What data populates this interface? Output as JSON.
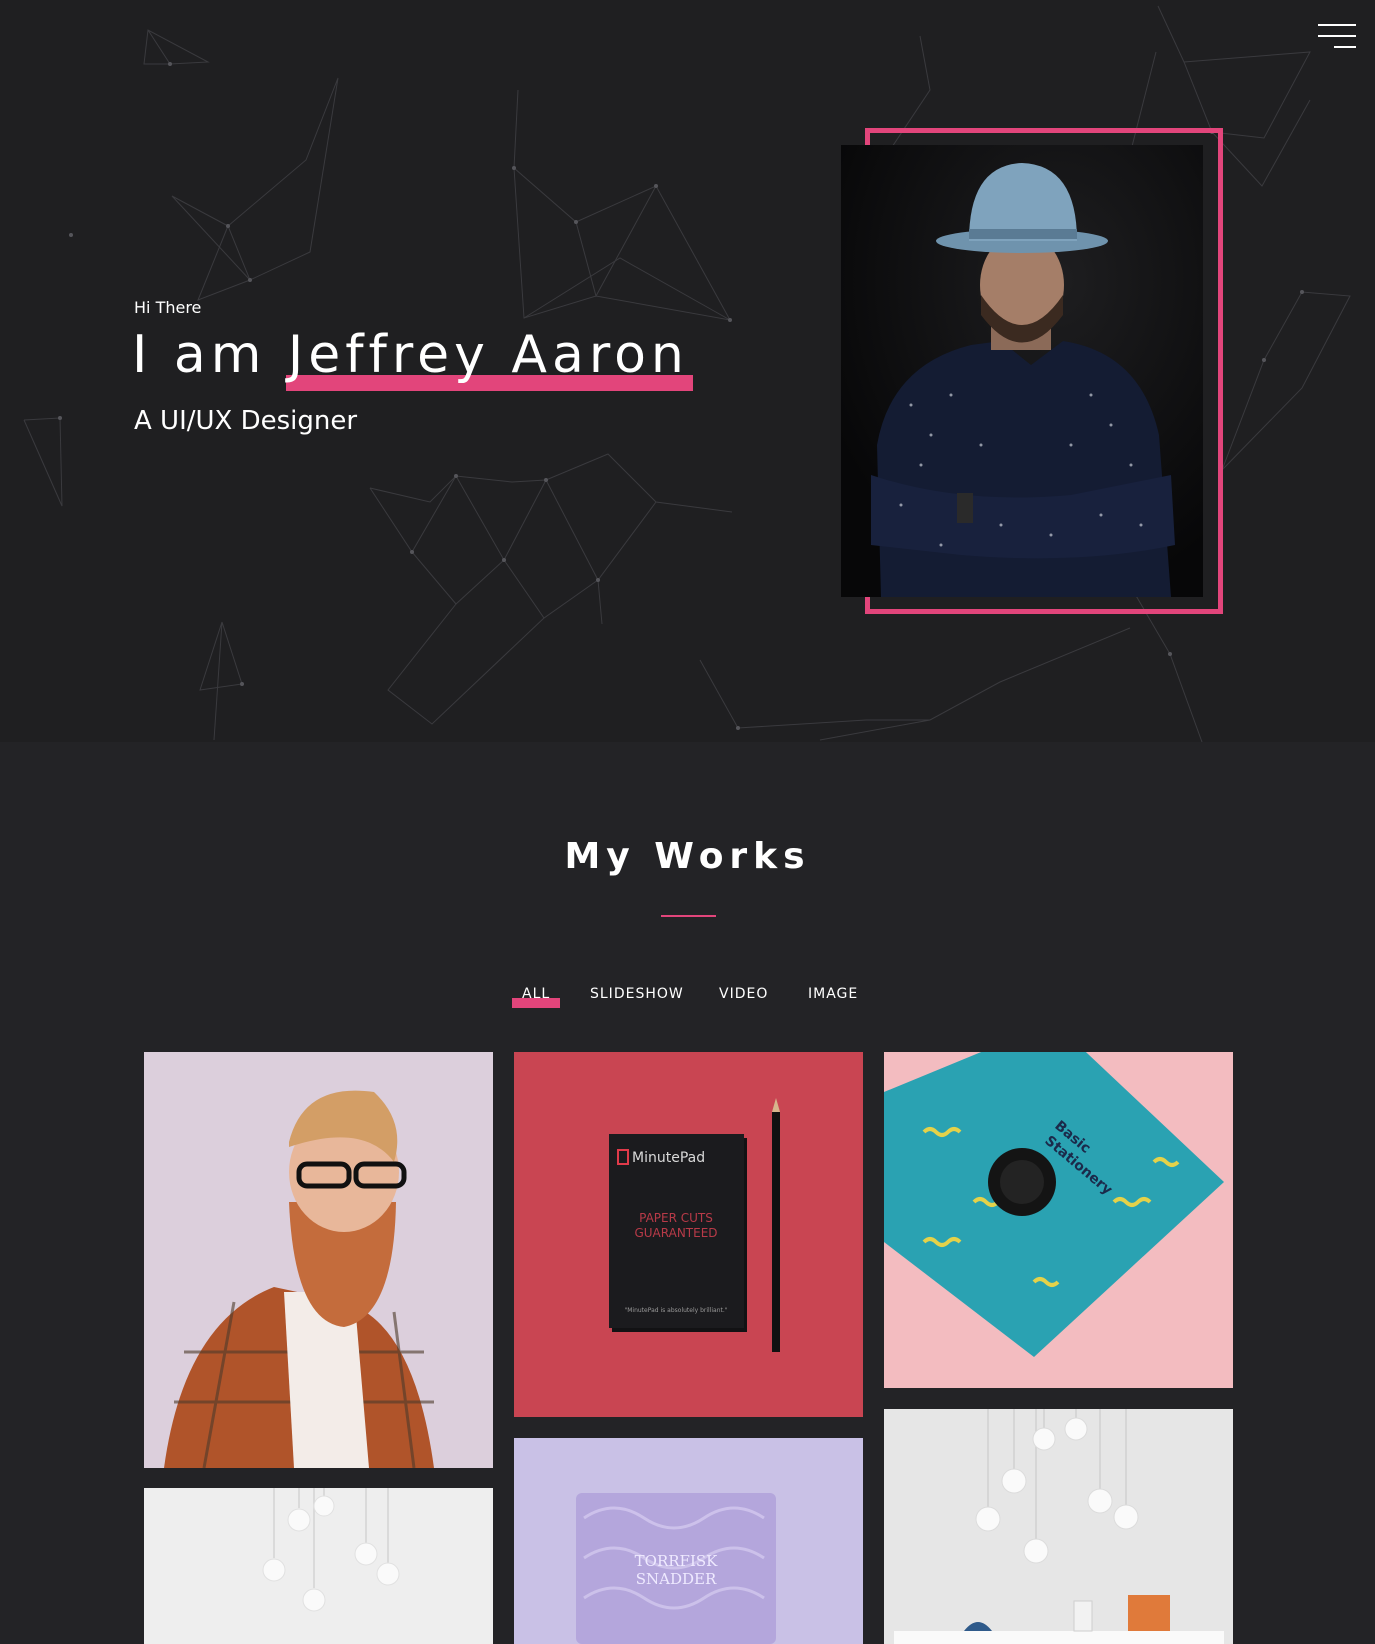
{
  "hero": {
    "greeting": "Hi There",
    "headline_prefix": "I am",
    "name": "Jeffrey Aaron",
    "role": "A UI/UX Designer"
  },
  "works": {
    "title": "My Works",
    "filters": [
      "ALL",
      "SLIDESHOW",
      "VIDEO",
      "IMAGE"
    ],
    "active_filter": "ALL",
    "card_minutepad": {
      "brand": "MinutePad",
      "slogan_1": "PAPER CUTS",
      "slogan_2": "GUARANTEED",
      "quote": "\"MinutePad is absolutely brilliant.\""
    },
    "card_stationery": {
      "line_1": "Basic",
      "line_2": "Stationery"
    },
    "card_package": {
      "line_1": "TORRFISK",
      "line_2": "SNADDER"
    }
  },
  "colors": {
    "accent": "#e2457b",
    "hero_bg": "#1f1f21",
    "section_bg": "#232326"
  },
  "icons": [
    "hamburger-menu-icon"
  ]
}
